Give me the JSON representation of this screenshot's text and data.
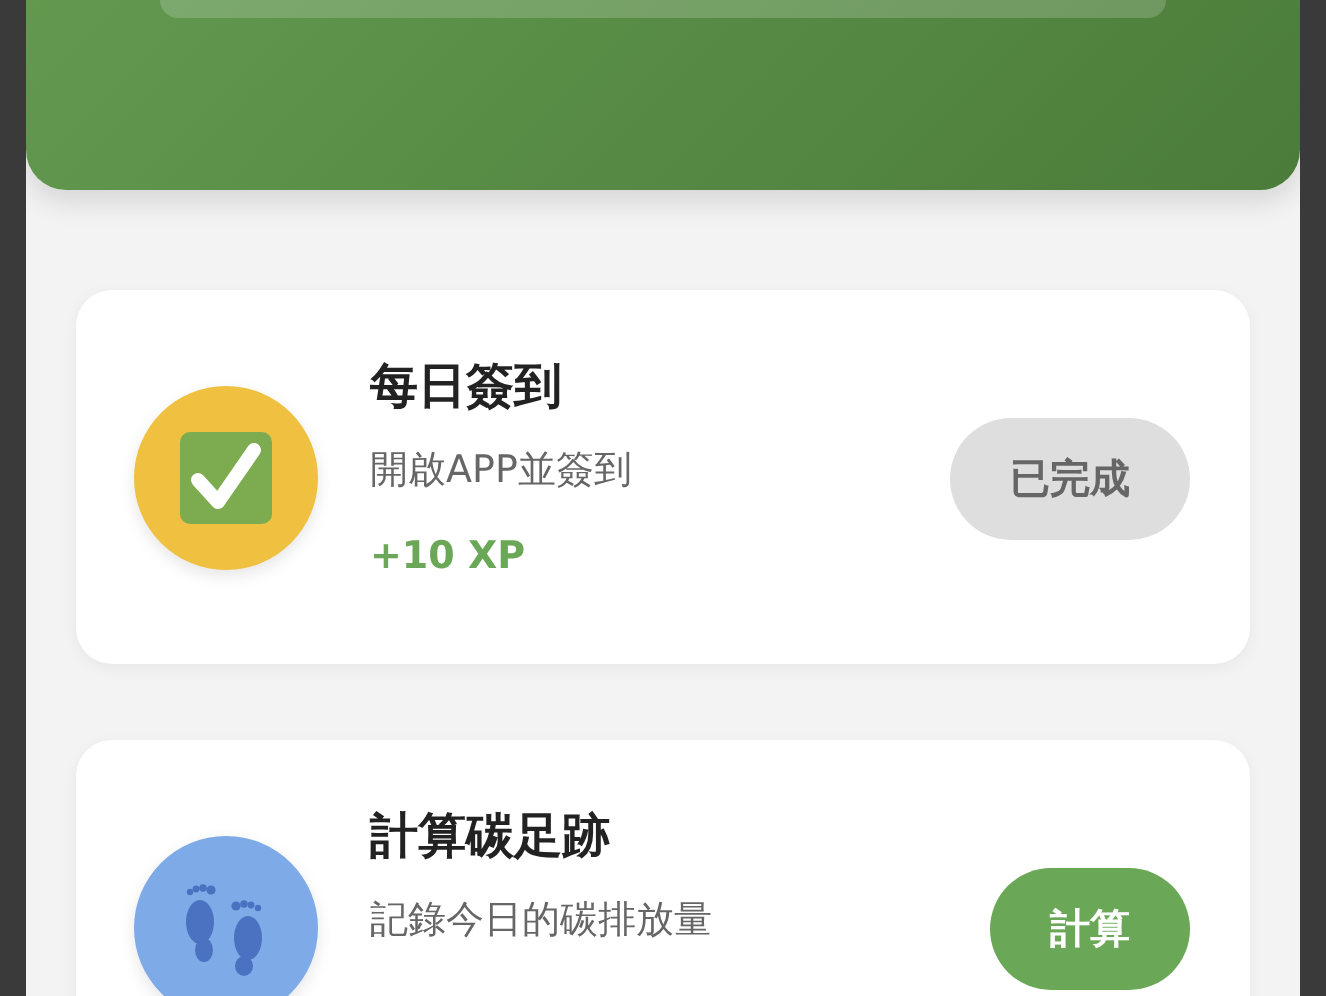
{
  "tasks": [
    {
      "kind": "checkin",
      "title": "每日簽到",
      "description": "開啟APP並簽到",
      "reward": "+10 XP",
      "button": "已完成",
      "completed": true
    },
    {
      "kind": "footprint",
      "title": "計算碳足跡",
      "description": "記錄今日的碳排放量",
      "button": "計算",
      "completed": false
    }
  ]
}
